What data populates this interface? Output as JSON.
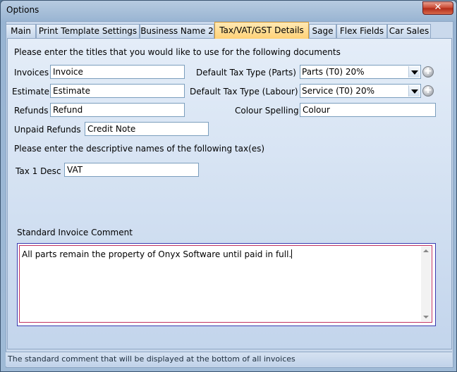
{
  "window": {
    "title": "Options",
    "close_glyph": "✕"
  },
  "tabs": [
    {
      "label": "Main",
      "active": false
    },
    {
      "label": "Print Template Settings",
      "active": false
    },
    {
      "label": "Business Name 2",
      "active": false
    },
    {
      "label": "Tax/VAT/GST Details",
      "active": true
    },
    {
      "label": "Sage",
      "active": false
    },
    {
      "label": "Flex Fields",
      "active": false
    },
    {
      "label": "Car Sales",
      "active": false
    }
  ],
  "documents": {
    "heading": "Please enter the titles that you would like to use for the following documents",
    "invoices": {
      "label": "Invoices",
      "value": "Invoice"
    },
    "estimate": {
      "label": "Estimate",
      "value": "Estimate"
    },
    "refunds": {
      "label": "Refunds",
      "value": "Refund"
    },
    "unpaid_refunds": {
      "label": "Unpaid Refunds",
      "value": "Credit Note"
    }
  },
  "tax_types": {
    "parts": {
      "label": "Default Tax Type (Parts)",
      "value": "Parts (T0) 20%"
    },
    "labour": {
      "label": "Default Tax Type (Labour)",
      "value": "Service (T0) 20%"
    },
    "colour_spelling": {
      "label": "Colour Spelling",
      "value": "Colour"
    }
  },
  "tax_desc": {
    "heading": "Please enter the descriptive names of the following tax(es)",
    "tax1": {
      "label": "Tax 1 Desc",
      "value": "VAT"
    }
  },
  "comment": {
    "label": "Standard Invoice Comment",
    "value": "All parts remain the property of Onyx Software until paid in full."
  },
  "status_text": "The standard comment that will be displayed at the bottom of all invoices",
  "icons": {
    "add": "plus-circle-icon",
    "dropdown": "chevron-down-icon"
  }
}
